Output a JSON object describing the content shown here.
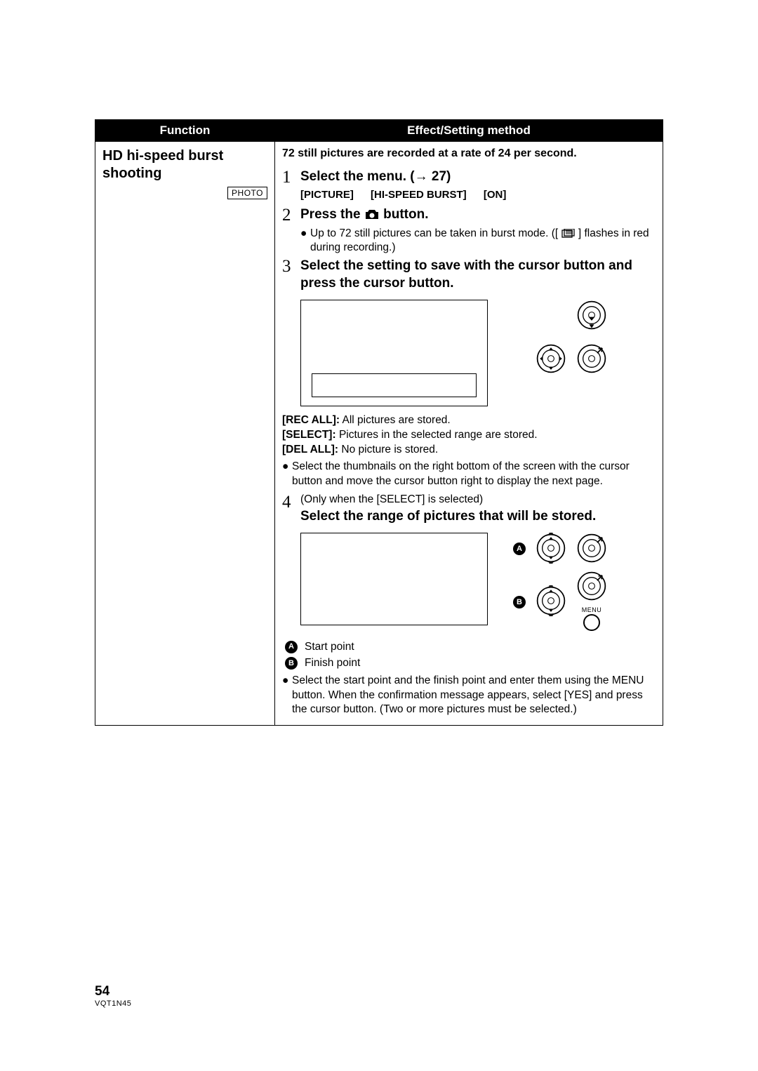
{
  "header": {
    "func_col": "Function",
    "effect_col": "Effect/Setting method"
  },
  "func": {
    "title_line1": "HD hi-speed burst",
    "title_line2": "shooting",
    "tag": "PHOTO"
  },
  "lead": "72 still pictures are recorded at a rate of 24 per second.",
  "step1": {
    "num": "1",
    "title_a": "Select the menu. (",
    "title_arrow": "→",
    "title_b": " 27)",
    "path1": "[PICTURE]",
    "path2": "[HI-SPEED BURST]",
    "path3": "[ON]"
  },
  "step2": {
    "num": "2",
    "title_a": "Press the ",
    "title_b": " button.",
    "bullet_a": "Up to 72 still pictures can be taken in burst mode. ([",
    "bullet_b": "] flashes in red during recording.)"
  },
  "step3": {
    "num": "3",
    "title": "Select the setting to save with the cursor button and press the cursor button."
  },
  "opts": {
    "rec_all_k": "[REC ALL]:",
    "rec_all_v": " All pictures are stored.",
    "select_k": "[SELECT]:",
    "select_v": " Pictures in the selected range are stored.",
    "del_all_k": "[DEL ALL]:",
    "del_all_v": " No picture is stored.",
    "bullet": "Select the thumbnails on the right bottom of the screen with the cursor button and move the cursor button right to display the next page."
  },
  "step4": {
    "num": "4",
    "sub": "(Only when the [SELECT] is selected)",
    "title": "Select the range of pictures that will be stored.",
    "menu_caption": "MENU",
    "label_a": "A",
    "label_b": "B",
    "legend_a": "Start point",
    "legend_b": "Finish point",
    "bullet": "Select the start point and the finish point and enter them using the MENU button. When the confirmation message appears, select [YES] and press the cursor button. (Two or more pictures must be selected.)"
  },
  "footer": {
    "page": "54",
    "doc": "VQT1N45"
  }
}
